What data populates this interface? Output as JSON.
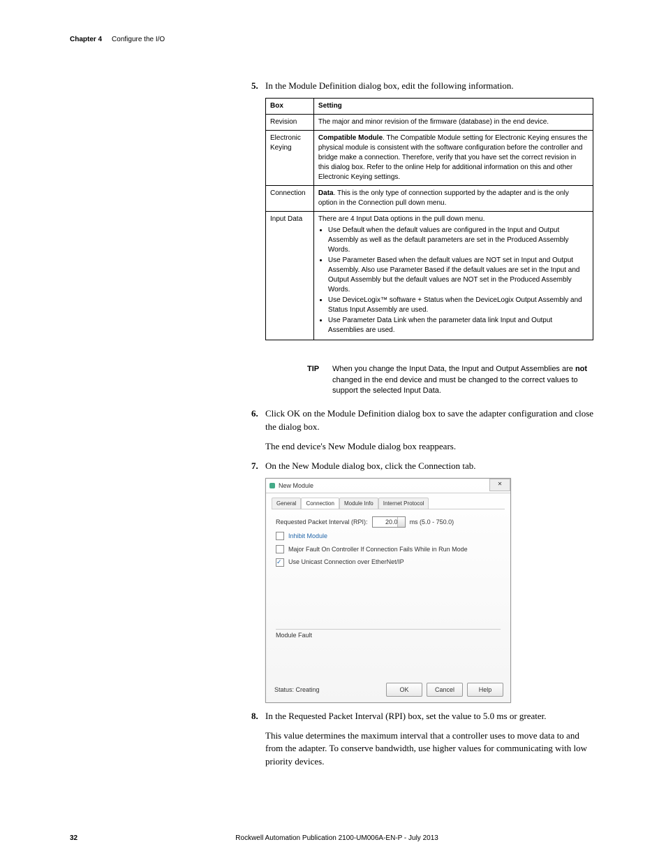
{
  "header": {
    "chapter": "Chapter 4",
    "title": "Configure the I/O"
  },
  "step5": {
    "num": "5.",
    "text": "In the Module Definition dialog box, edit the following information."
  },
  "table": {
    "head": {
      "box": "Box",
      "setting": "Setting"
    },
    "rows": [
      {
        "box": "Revision",
        "setting": "The major and minor revision of the firmware (database) in the end device."
      },
      {
        "box": "Electronic Keying",
        "setting_bold": "Compatible Module",
        "setting_rest": ". The Compatible Module setting for Electronic Keying ensures the physical module is consistent with the software configuration before the controller and bridge make a connection. Therefore, verify that you have set the correct revision in this dialog box. Refer to the online Help for additional information on this and other Electronic Keying settings."
      },
      {
        "box": "Connection",
        "setting_bold": "Data",
        "setting_rest": ". This is the only type of connection supported by the adapter and is the only option in the Connection pull down menu."
      },
      {
        "box": "Input Data",
        "setting_plain": "There are 4 Input Data options in the pull down menu.",
        "bullets": [
          "Use Default when the default values are configured in the Input and Output Assembly as well as the default parameters are set in the Produced Assembly Words.",
          "Use Parameter Based when the default values are NOT set in Input and Output Assembly. Also use Parameter Based if the default values are set in the Input and Output Assembly but the default values are NOT set in the Produced Assembly Words.",
          "Use DeviceLogix™ software + Status when the DeviceLogix Output Assembly and Status Input Assembly are used.",
          "Use Parameter Data Link when the parameter data link Input and Output Assemblies are used."
        ]
      }
    ]
  },
  "tip": {
    "label": "TIP",
    "pre": "When you change the Input Data, the Input and Output Assemblies are ",
    "bold": "not",
    "post": " changed in the end device and must be changed to the correct values to support the selected Input Data."
  },
  "step6": {
    "num": "6.",
    "text": "Click OK on the Module Definition dialog box to save the adapter configuration and close the dialog box."
  },
  "afterStep6": "The end device's New Module dialog box reappears.",
  "step7": {
    "num": "7.",
    "text": "On the New Module dialog box, click the Connection tab."
  },
  "dialog": {
    "title": "New Module",
    "tabs": {
      "general": "General",
      "connection": "Connection",
      "moduleinfo": "Module Info",
      "internet": "Internet Protocol"
    },
    "rpi_label": "Requested Packet Interval (RPI):",
    "rpi_value": "20.0",
    "rpi_range": "ms (5.0 - 750.0)",
    "inhibit": "Inhibit Module",
    "majorfault": "Major Fault On Controller If Connection Fails While in Run Mode",
    "unicast": "Use Unicast Connection over EtherNet/IP",
    "fault_label": "Module Fault",
    "status": "Status: Creating",
    "ok": "OK",
    "cancel": "Cancel",
    "help": "Help"
  },
  "step8": {
    "num": "8.",
    "text": "In the Requested Packet Interval (RPI) box, set the value to 5.0 ms or greater."
  },
  "afterStep8": "This value determines the maximum interval that a controller uses to move data to and from the adapter. To conserve bandwidth, use higher values for communicating with low priority devices.",
  "footer": {
    "page": "32",
    "pub": "Rockwell Automation Publication 2100-UM006A-EN-P - July 2013"
  }
}
